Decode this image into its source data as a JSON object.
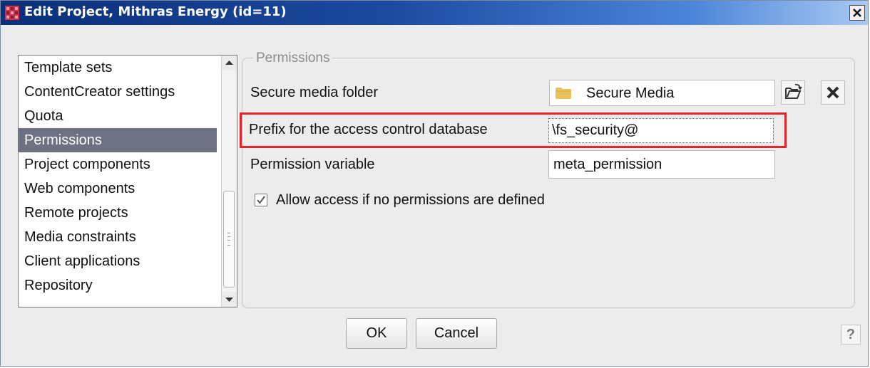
{
  "window": {
    "title": "Edit Project, Mithras Energy (id=11)"
  },
  "sidebar": {
    "items": [
      {
        "label": "Template sets"
      },
      {
        "label": "ContentCreator settings"
      },
      {
        "label": "Quota"
      },
      {
        "label": "Permissions",
        "selected": true
      },
      {
        "label": "Project components"
      },
      {
        "label": "Web components"
      },
      {
        "label": "Remote projects"
      },
      {
        "label": "Media constraints"
      },
      {
        "label": "Client applications"
      },
      {
        "label": "Repository"
      }
    ]
  },
  "permissions": {
    "legend": "Permissions",
    "secure_media_label": "Secure media folder",
    "secure_media_value": "Secure Media",
    "prefix_label": "Prefix for the access control database",
    "prefix_value": "\\fs_security@",
    "permvar_label": "Permission variable",
    "permvar_value": "meta_permission",
    "allow_access_label": "Allow access if no permissions are defined",
    "allow_access_checked": true
  },
  "footer": {
    "ok_label": "OK",
    "cancel_label": "Cancel",
    "help_label": "?"
  },
  "icons": {
    "app": "app-icon",
    "folder": "folder-icon",
    "browse": "browse-folder-icon",
    "clear": "clear-icon",
    "close": "close-icon",
    "scroll_up": "chevron-up-icon",
    "scroll_down": "chevron-down-icon",
    "checkbox": "checkmark-icon"
  },
  "colors": {
    "titlebar_start": "#0b2f79",
    "titlebar_end": "#a9c9f2",
    "selection": "#6e7181",
    "highlight": "#e0262b",
    "folder": "#e8c25a"
  }
}
